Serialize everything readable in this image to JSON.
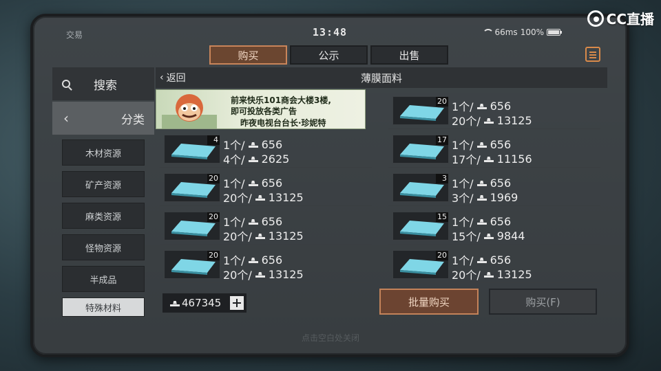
{
  "status_bar": {
    "app_label": "交易",
    "time": "13:48",
    "network": "66ms",
    "battery": "100%"
  },
  "watermark": {
    "text": "CC直播"
  },
  "tabs": [
    {
      "label": "购买",
      "active": true
    },
    {
      "label": "公示",
      "active": false
    },
    {
      "label": "出售",
      "active": false
    }
  ],
  "sidebar": {
    "search_label": "搜索",
    "category_label": "分类",
    "categories": [
      {
        "label": "木材资源",
        "selected": false
      },
      {
        "label": "矿产资源",
        "selected": false
      },
      {
        "label": "麻类资源",
        "selected": false
      },
      {
        "label": "怪物资源",
        "selected": false
      },
      {
        "label": "半成品",
        "selected": false
      },
      {
        "label": "特殊材料",
        "selected": true
      }
    ]
  },
  "list": {
    "back_label": "返回",
    "title": "薄膜面料"
  },
  "ad": {
    "line1": "前来快乐101商会大楼3楼,",
    "line2": "即可投放各类广告",
    "line3": "昨夜电视台台长·珍妮特"
  },
  "listings_left": [
    {
      "qty": "4",
      "unit": "1个/",
      "unit_price": "656",
      "count_label": "4个/",
      "total": "2625"
    },
    {
      "qty": "20",
      "unit": "1个/",
      "unit_price": "656",
      "count_label": "20个/",
      "total": "13125"
    },
    {
      "qty": "20",
      "unit": "1个/",
      "unit_price": "656",
      "count_label": "20个/",
      "total": "13125"
    },
    {
      "qty": "20",
      "unit": "1个/",
      "unit_price": "656",
      "count_label": "20个/",
      "total": "13125"
    }
  ],
  "listings_right": [
    {
      "qty": "20",
      "unit": "1个/",
      "unit_price": "656",
      "count_label": "20个/",
      "total": "13125"
    },
    {
      "qty": "17",
      "unit": "1个/",
      "unit_price": "656",
      "count_label": "17个/",
      "total": "11156"
    },
    {
      "qty": "3",
      "unit": "1个/",
      "unit_price": "656",
      "count_label": "3个/",
      "total": "1969"
    },
    {
      "qty": "15",
      "unit": "1个/",
      "unit_price": "656",
      "count_label": "15个/",
      "total": "9844"
    },
    {
      "qty": "20",
      "unit": "1个/",
      "unit_price": "656",
      "count_label": "20个/",
      "total": "13125"
    }
  ],
  "footer": {
    "balance": "467345",
    "bulk_buy_label": "批量购买",
    "buy_label": "购买(F)",
    "hint": "点击空白处关闭"
  },
  "colors": {
    "accent": "#c4835a",
    "active_tab": "#6b4630",
    "panel": "#444a4e"
  }
}
